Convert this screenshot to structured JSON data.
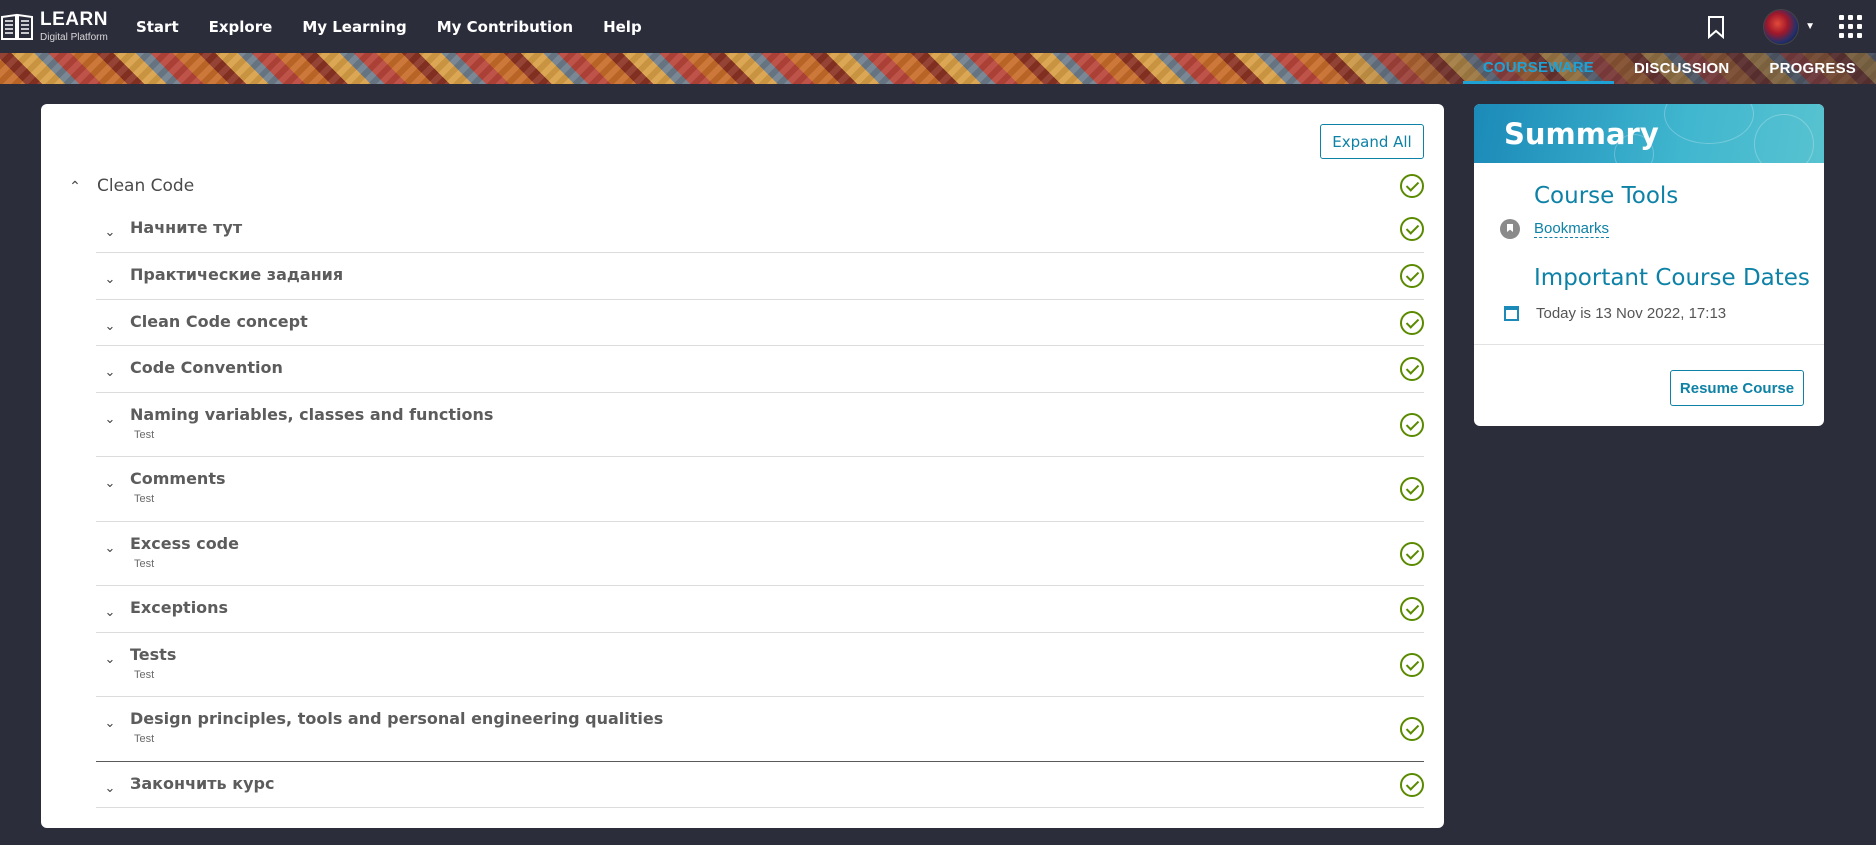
{
  "header": {
    "brand_title": "LEARN",
    "brand_subtitle": "Digital Platform",
    "nav": [
      "Start",
      "Explore",
      "My Learning",
      "My Contribution",
      "Help"
    ]
  },
  "course_tabs": [
    {
      "label": "COURSEWARE",
      "active": true
    },
    {
      "label": "DISCUSSION",
      "active": false
    },
    {
      "label": "PROGRESS",
      "active": false
    }
  ],
  "courseware": {
    "expand_all_label": "Expand All",
    "section_title": "Clean Code",
    "subsections": [
      {
        "title": "Начните тут",
        "tag": ""
      },
      {
        "title": "Практические задания",
        "tag": ""
      },
      {
        "title": "Clean Code concept",
        "tag": ""
      },
      {
        "title": "Code Convention",
        "tag": ""
      },
      {
        "title": "Naming variables, classes and functions",
        "tag": "Test"
      },
      {
        "title": "Comments",
        "tag": "Test"
      },
      {
        "title": "Excess code",
        "tag": "Test"
      },
      {
        "title": "Exceptions",
        "tag": ""
      },
      {
        "title": "Tests",
        "tag": "Test"
      },
      {
        "title": "Design principles, tools and personal engineering qualities",
        "tag": "Test"
      },
      {
        "title": "Закончить курс",
        "tag": ""
      }
    ]
  },
  "summary": {
    "title": "Summary",
    "course_tools_title": "Course Tools",
    "bookmarks_label": "Bookmarks",
    "dates_title": "Important Course Dates",
    "today_text": "Today is 13 Nov 2022, 17:13",
    "resume_label": "Resume Course"
  },
  "colors": {
    "accent": "#0e82a6",
    "check": "#5a8a00",
    "background": "#2b2d3b"
  }
}
